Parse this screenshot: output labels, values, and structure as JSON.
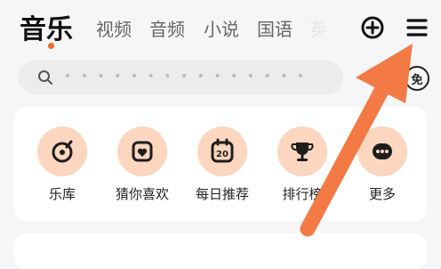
{
  "top_tabs": [
    {
      "label": "音乐",
      "active": true
    },
    {
      "label": "视频"
    },
    {
      "label": "音频"
    },
    {
      "label": "小说"
    },
    {
      "label": "国语"
    },
    {
      "label": "英语"
    }
  ],
  "header_icons": {
    "add": "plus-circle-icon",
    "menu": "hamburger-menu-icon"
  },
  "search": {
    "placeholder": "• • • • • • • • • • • • • • •",
    "icon": "search-icon"
  },
  "free_badge": "免",
  "quick_entries": [
    {
      "label": "乐库",
      "icon": "record-note-icon"
    },
    {
      "label": "猜你喜欢",
      "icon": "heart-tag-icon"
    },
    {
      "label": "每日推荐",
      "icon": "calendar-20-icon",
      "icon_text": "20"
    },
    {
      "label": "排行榜",
      "icon": "trophy-icon"
    },
    {
      "label": "更多",
      "icon": "more-dots-icon"
    }
  ],
  "colors": {
    "accent": "#f26a2c",
    "icon_bg": "#fcd6be",
    "icon_stroke": "#1e1e1e",
    "arrow": "#f37a45"
  }
}
